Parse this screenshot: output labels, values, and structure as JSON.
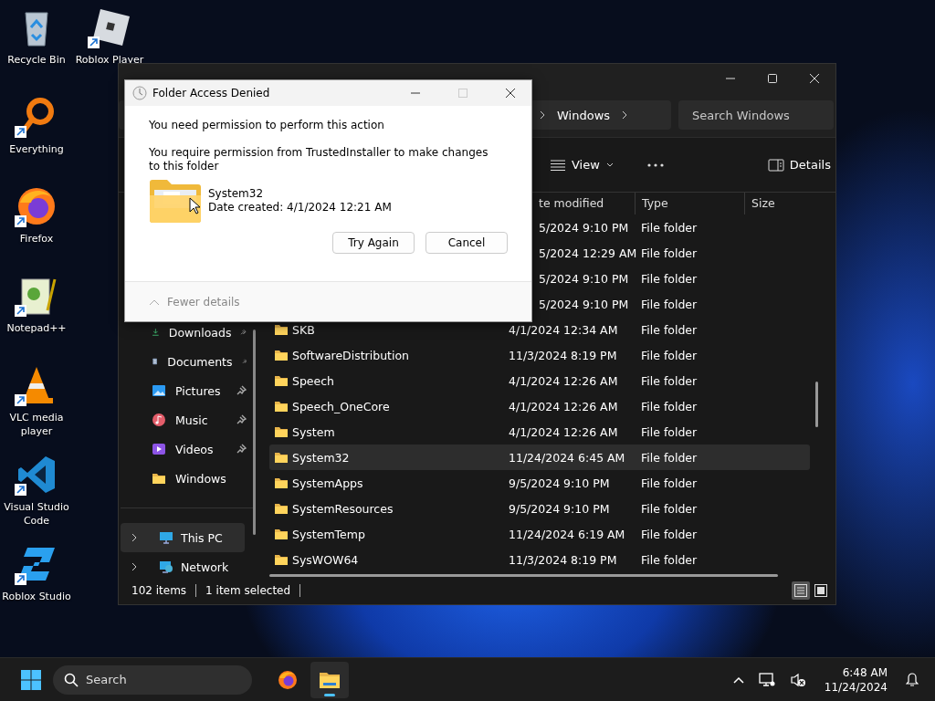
{
  "desktop_icons": [
    {
      "label": "Recycle Bin",
      "kind": "recycle",
      "shortcut": false
    },
    {
      "label": "Roblox Player",
      "kind": "roblox",
      "shortcut": true
    },
    {
      "label": "Everything",
      "kind": "everything",
      "shortcut": true
    },
    {
      "label": "Firefox",
      "kind": "firefox",
      "shortcut": true
    },
    {
      "label": "Notepad++",
      "kind": "notepad",
      "shortcut": true
    },
    {
      "label": "VLC media player",
      "kind": "vlc",
      "shortcut": true
    },
    {
      "label": "Visual Studio Code",
      "kind": "vscode",
      "shortcut": true
    },
    {
      "label": "Roblox Studio",
      "kind": "studio",
      "shortcut": true
    }
  ],
  "explorer": {
    "address": [
      "Windows"
    ],
    "search": {
      "placeholder": "Search Windows"
    },
    "toolbar": {
      "view": "View",
      "details": "Details"
    },
    "columns": [
      "te modified",
      "Type",
      "Size"
    ],
    "nav": [
      {
        "label": "Downloads",
        "kind": "downloads",
        "pinned": true
      },
      {
        "label": "Documents",
        "kind": "documents",
        "pinned": true
      },
      {
        "label": "Pictures",
        "kind": "pictures",
        "pinned": true
      },
      {
        "label": "Music",
        "kind": "music",
        "pinned": true
      },
      {
        "label": "Videos",
        "kind": "videos",
        "pinned": true
      },
      {
        "label": "Windows",
        "kind": "folder",
        "pinned": false
      }
    ],
    "nav_bottom": [
      {
        "label": "This PC",
        "kind": "pc",
        "selected": true
      },
      {
        "label": "Network",
        "kind": "network",
        "selected": false
      }
    ],
    "rows": [
      {
        "modified": "5/2024 9:10 PM",
        "type": "File folder",
        "selected": false
      },
      {
        "modified": "5/2024 12:29 AM",
        "type": "File folder",
        "selected": false
      },
      {
        "modified": "5/2024 9:10 PM",
        "type": "File folder",
        "selected": false
      },
      {
        "modified": "5/2024 9:10 PM",
        "type": "File folder",
        "selected": false
      },
      {
        "name": "SKB",
        "modified": "4/1/2024 12:34 AM",
        "type": "File folder",
        "selected": false
      },
      {
        "name": "SoftwareDistribution",
        "modified": "11/3/2024 8:19 PM",
        "type": "File folder",
        "selected": false
      },
      {
        "name": "Speech",
        "modified": "4/1/2024 12:26 AM",
        "type": "File folder",
        "selected": false
      },
      {
        "name": "Speech_OneCore",
        "modified": "4/1/2024 12:26 AM",
        "type": "File folder",
        "selected": false
      },
      {
        "name": "System",
        "modified": "4/1/2024 12:26 AM",
        "type": "File folder",
        "selected": false
      },
      {
        "name": "System32",
        "modified": "11/24/2024 6:45 AM",
        "type": "File folder",
        "selected": true
      },
      {
        "name": "SystemApps",
        "modified": "9/5/2024 9:10 PM",
        "type": "File folder",
        "selected": false
      },
      {
        "name": "SystemResources",
        "modified": "9/5/2024 9:10 PM",
        "type": "File folder",
        "selected": false
      },
      {
        "name": "SystemTemp",
        "modified": "11/24/2024 6:19 AM",
        "type": "File folder",
        "selected": false
      },
      {
        "name": "SysWOW64",
        "modified": "11/3/2024 8:19 PM",
        "type": "File folder",
        "selected": false
      }
    ],
    "status": {
      "items": "102 items",
      "selection": "1 item selected"
    },
    "views": [
      {
        "kind": "details",
        "selected": true
      },
      {
        "kind": "tiles",
        "selected": false
      }
    ]
  },
  "dialog": {
    "title": "Folder Access Denied",
    "heading": "You need permission to perform this action",
    "message": "You require permission from TrustedInstaller to make changes to this folder",
    "folder_name": "System32",
    "folder_date": "Date created: 4/1/2024 12:21 AM",
    "buttons": [
      "Try Again",
      "Cancel"
    ],
    "details_toggle": "Fewer details"
  },
  "taskbar": {
    "search": {
      "placeholder": "Search"
    },
    "apps": [
      {
        "kind": "firefox",
        "active": false
      },
      {
        "kind": "explorer",
        "active": true
      }
    ],
    "time": "6:48 AM",
    "date": "11/24/2024"
  }
}
